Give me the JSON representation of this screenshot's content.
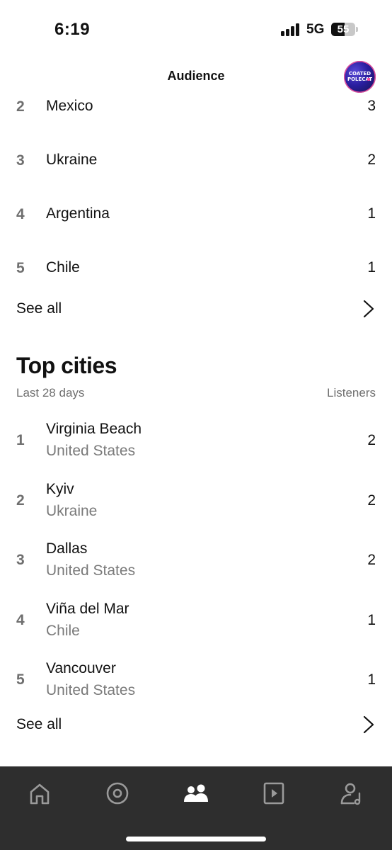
{
  "status_bar": {
    "time": "6:19",
    "network": "5G",
    "battery": "55"
  },
  "header": {
    "title": "Audience",
    "avatar_line1": "COATED",
    "avatar_line2": "POLECAT"
  },
  "countries": {
    "items": [
      {
        "rank": "2",
        "name": "Mexico",
        "value": "3"
      },
      {
        "rank": "3",
        "name": "Ukraine",
        "value": "2"
      },
      {
        "rank": "4",
        "name": "Argentina",
        "value": "1"
      },
      {
        "rank": "5",
        "name": "Chile",
        "value": "1"
      }
    ],
    "see_all": "See all"
  },
  "cities": {
    "title": "Top cities",
    "period": "Last 28 days",
    "column": "Listeners",
    "items": [
      {
        "rank": "1",
        "city": "Virginia Beach",
        "country": "United States",
        "value": "2"
      },
      {
        "rank": "2",
        "city": "Kyiv",
        "country": "Ukraine",
        "value": "2"
      },
      {
        "rank": "3",
        "city": "Dallas",
        "country": "United States",
        "value": "2"
      },
      {
        "rank": "4",
        "city": "Viña del Mar",
        "country": "Chile",
        "value": "1"
      },
      {
        "rank": "5",
        "city": "Vancouver",
        "country": "United States",
        "value": "1"
      }
    ],
    "see_all": "See all"
  },
  "bottom_nav": {
    "items": [
      {
        "icon": "home-icon",
        "active": false
      },
      {
        "icon": "disc-icon",
        "active": false
      },
      {
        "icon": "audience-icon",
        "active": true
      },
      {
        "icon": "video-icon",
        "active": false
      },
      {
        "icon": "profile-music-icon",
        "active": false
      }
    ],
    "active_color": "#ffffff",
    "inactive_color": "#9a9a9a"
  },
  "colors": {
    "rank": "#6f6f6f",
    "secondary": "#7a7a7a",
    "nav_background": "#2e2e2e"
  }
}
